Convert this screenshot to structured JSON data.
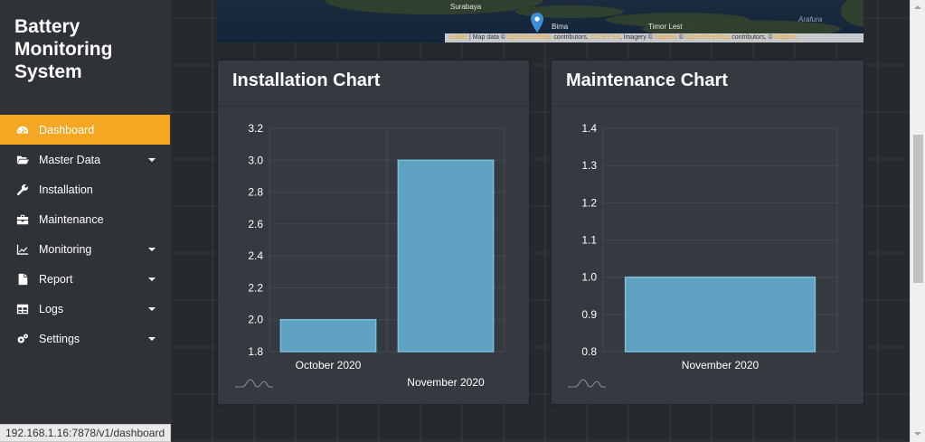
{
  "app": {
    "title_lines": [
      "Battery",
      "Monitoring",
      "System"
    ]
  },
  "sidebar": {
    "items": [
      {
        "label": "Dashboard",
        "icon": "dashboard-icon",
        "active": true,
        "dropdown": false
      },
      {
        "label": "Master Data",
        "icon": "folder-open-icon",
        "active": false,
        "dropdown": true
      },
      {
        "label": "Installation",
        "icon": "wrench-icon",
        "active": false,
        "dropdown": false
      },
      {
        "label": "Maintenance",
        "icon": "toolbox-icon",
        "active": false,
        "dropdown": false
      },
      {
        "label": "Monitoring",
        "icon": "line-chart-icon",
        "active": false,
        "dropdown": true
      },
      {
        "label": "Report",
        "icon": "file-icon",
        "active": false,
        "dropdown": true
      },
      {
        "label": "Logs",
        "icon": "table-icon",
        "active": false,
        "dropdown": true
      },
      {
        "label": "Settings",
        "icon": "gears-icon",
        "active": false,
        "dropdown": true
      }
    ]
  },
  "statusbar": {
    "url": "192.168.1.16:7878/v1/dashboard"
  },
  "map": {
    "labels": {
      "surabaya": "Surabaya",
      "bima": "Bima",
      "timor": "Timor Lest",
      "arafura": "Arafura"
    },
    "attribution": {
      "leaflet": "Leaflet",
      "map_data": " | Map data © ",
      "osm": "OpenStreetMap",
      "contributors": " contributors, ",
      "ccbysa": "CC-BY-SA",
      "imagery": ", Imagery © ",
      "mapbox": "Mapbox",
      "tail": " © ",
      "osm2": "OpenStreetMap",
      "contributors2": " contributors, © ",
      "mapbox2": "Mapbox"
    }
  },
  "colors": {
    "accent": "#f5a623",
    "bar_fill": "#5fa1c1",
    "bar_stroke": "#7dbedc",
    "grid": "#45494f"
  },
  "cards": {
    "installation": {
      "title": "Installation Chart"
    },
    "maintenance": {
      "title": "Maintenance Chart"
    }
  },
  "chart_data": [
    {
      "type": "bar",
      "title": "Installation Chart",
      "categories": [
        "October 2020",
        "November 2020"
      ],
      "values": [
        2.0,
        3.0
      ],
      "ylim": [
        1.8,
        3.2
      ],
      "yticks": [
        "3.2",
        "3.0",
        "2.8",
        "2.6",
        "2.4",
        "2.2",
        "2.0",
        "1.8"
      ],
      "grid": true,
      "xlabel": "",
      "ylabel": ""
    },
    {
      "type": "bar",
      "title": "Maintenance Chart",
      "categories": [
        "November 2020"
      ],
      "values": [
        1.0
      ],
      "ylim": [
        0.8,
        1.4
      ],
      "yticks": [
        "1.4",
        "1.3",
        "1.2",
        "1.1",
        "1.0",
        "0.9",
        "0.8"
      ],
      "grid": true,
      "xlabel": "",
      "ylabel": ""
    }
  ]
}
